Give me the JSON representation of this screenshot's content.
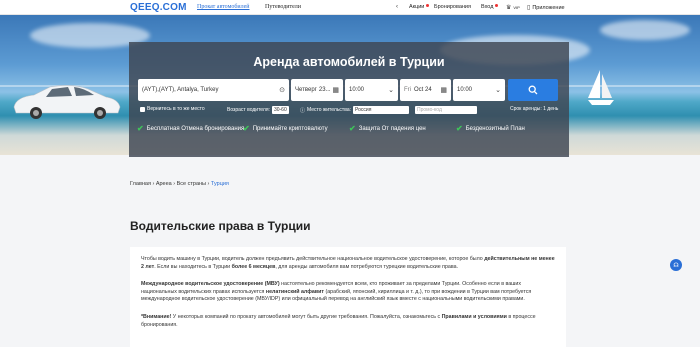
{
  "header": {
    "logo": "QEEQ.COM",
    "nav": [
      "Прокат автомобилей",
      "Путеводители"
    ],
    "actions": [
      "Акции",
      "Бронирования",
      "Вход",
      "Приложение"
    ],
    "vip": "VIP"
  },
  "search": {
    "title": "Аренда автомобилей в Турции",
    "location": "(AYT),(AYT), Antalya, Turkey",
    "pickup_day": "Четверг",
    "pickup_date": "23...",
    "pickup_time": "10:00",
    "return_day": "Fri",
    "return_date": "Oct 24",
    "return_time": "10:00",
    "return_same_label": "Вернитесь в то же место",
    "age_label": "Возраст водителя:",
    "age_value": "30-60",
    "residence_label": "Место жительства:",
    "residence_value": "Россия",
    "promo_placeholder": "Промо-код",
    "rental_period": "Срок аренды: 1 день"
  },
  "features": [
    "Бесплатная Отмена бронирования",
    "Принимайте криптовалюту",
    "Защита От падения цен",
    "Безденозитный План"
  ],
  "breadcrumb": [
    "Главная",
    "Арееа",
    "Все страны",
    "Турция"
  ],
  "page_title": "Водительские права в Турции",
  "content": {
    "p1a": "Чтобы водить машину в Турции, водитель должен предъявить действительное национальное водительское удостоверение, которое было ",
    "p1b": "действительным не менее 2 лет",
    "p1c": ". Если вы находитесь в Турции ",
    "p1d": "более 6 месяцев",
    "p1e": ", для аренды автомобиля вам потребуются турецкие водительские права.",
    "p2a": "Международное водительское удостоверение (МВУ)",
    "p2b": " настоятельно рекомендуется всем, кто проживает за пределами Турции. Особенно если в ваших национальных водительских правах используется ",
    "p2c": "нелатинский алфавит",
    "p2d": " (арабский, японский, кириллица и т. д.), то при вождении в Турции вам потребуется международное водительское удостоверение (МВУ/IDP) или официальный перевод на английский язык вместе с национальными водительскими правами.",
    "p3a": "*Внимание!",
    "p3b": " У некоторых компаний по прокату автомобилей могут быть другие требования. Пожалуйста, ознакомьтесь с ",
    "p3c": "Правилами и условиями",
    "p3d": " в процессе бронирования."
  },
  "colors": {
    "accent": "#2a6fd6",
    "button": "#2a7de1",
    "check": "#3ec35a"
  }
}
